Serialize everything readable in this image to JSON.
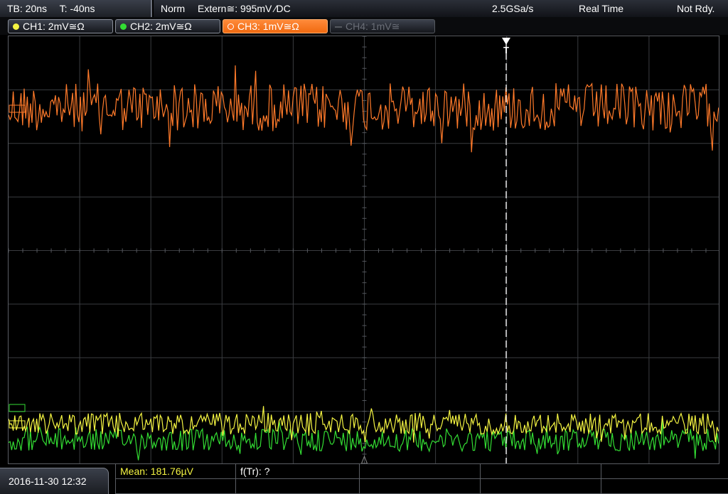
{
  "topbar": {
    "timebase": "TB: 20ns",
    "trigger_time": "T: -40ns",
    "mode": "Norm",
    "trigger_source": "Extern≅: 995mV ⁄DC",
    "sample_rate": "2.5GSa/s",
    "acq_mode": "Real Time",
    "status": "Not Rdy."
  },
  "channels": [
    {
      "label": "CH1: 2mV≅Ω",
      "color": "#f5f542",
      "active": true
    },
    {
      "label": "CH2: 2mV≅Ω",
      "color": "#33dd33",
      "active": true
    },
    {
      "label": "CH3: 1mV≅Ω",
      "color": "#ff7a2a",
      "active": true
    },
    {
      "label": "CH4: 1mV≅",
      "color": "#6a6e77",
      "active": false
    }
  ],
  "trigger_marker": "T",
  "bottom": {
    "datetime": "2016-11-30 12:32",
    "measurement_1": "Mean: 181.76µV",
    "measurement_2": "f(Tr): ?"
  },
  "colors": {
    "ch1": "#f5f542",
    "ch2": "#33dd33",
    "ch3": "#ff7a2a",
    "grid": "#3a3c40"
  }
}
